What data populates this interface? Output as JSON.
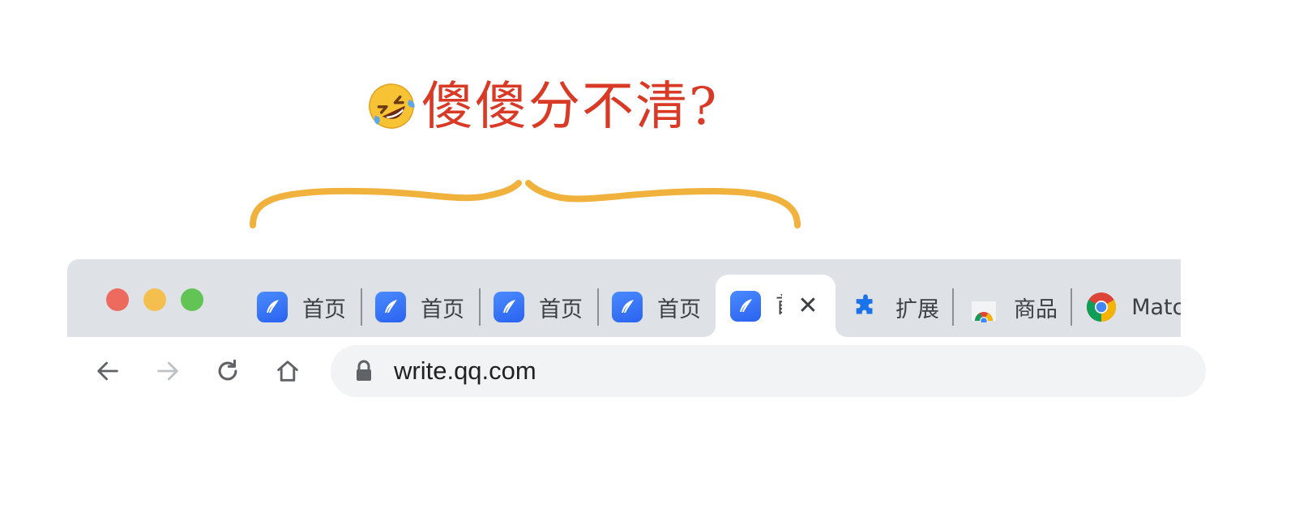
{
  "annotation": {
    "emoji": "🤣",
    "caption": "傻傻分不清?",
    "caption_color": "#d83a26",
    "brace_color": "#f0b23c"
  },
  "window": {
    "traffic_lights": [
      "close",
      "minimize",
      "maximize"
    ]
  },
  "tabs": [
    {
      "title": "首页",
      "icon": "quill-icon"
    },
    {
      "title": "首页",
      "icon": "quill-icon"
    },
    {
      "title": "首页",
      "icon": "quill-icon"
    },
    {
      "title": "首页",
      "icon": "quill-icon"
    },
    {
      "title": "首",
      "icon": "quill-icon",
      "active": true
    },
    {
      "title": "扩展",
      "icon": "puzzle-icon"
    },
    {
      "title": "商品",
      "icon": "chrome-web-store-icon"
    },
    {
      "title": "Match",
      "icon": "chrome-icon"
    }
  ],
  "toolbar": {
    "back": "back-arrow-icon",
    "forward": "forward-arrow-icon",
    "reload": "reload-icon",
    "home": "home-icon"
  },
  "omnibox": {
    "url": "write.qq.com",
    "icon": "lock-icon"
  },
  "colors": {
    "tabstrip": "#dee1e6",
    "favicon_blue": "#3373f5",
    "puzzle_blue": "#1a73e8"
  }
}
